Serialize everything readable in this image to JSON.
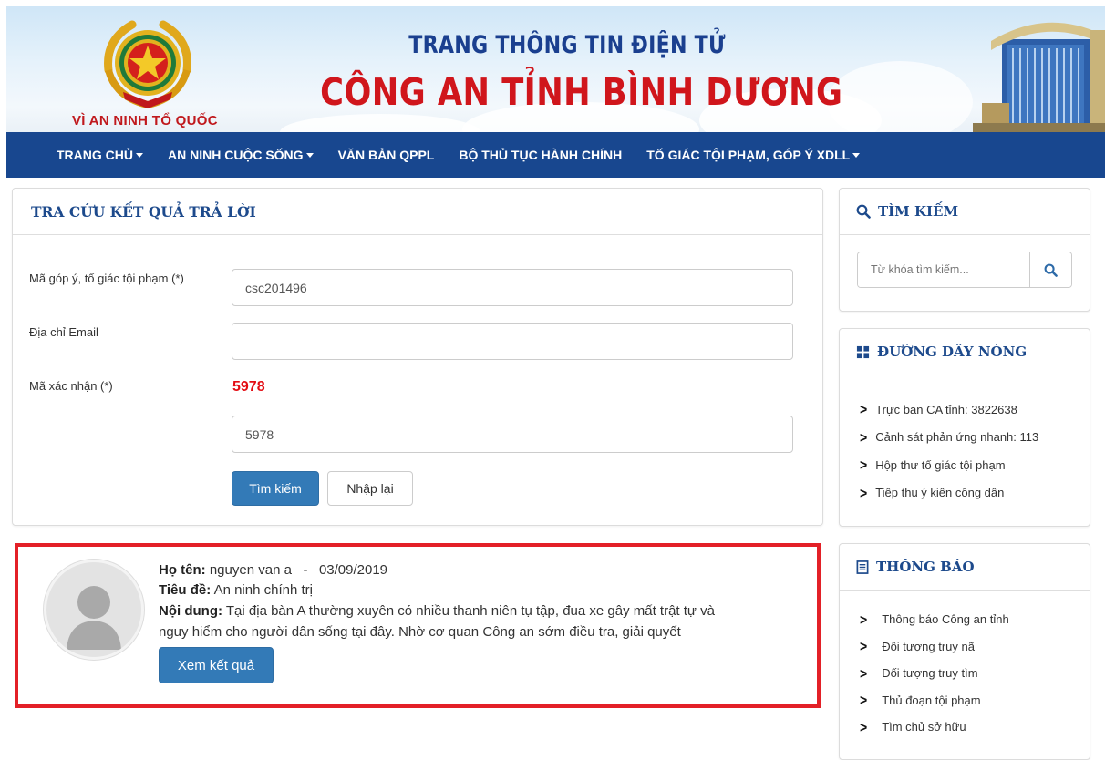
{
  "banner": {
    "motto": "VÌ AN NINH TỔ QUỐC",
    "title_top": "TRANG THÔNG TIN ĐIỆN TỬ",
    "title_main": "CÔNG AN TỈNH BÌNH DƯƠNG"
  },
  "nav": {
    "items": [
      {
        "label": "TRANG CHỦ",
        "has_dropdown": true
      },
      {
        "label": "AN NINH CUỘC SỐNG",
        "has_dropdown": true
      },
      {
        "label": "VĂN BẢN QPPL",
        "has_dropdown": false
      },
      {
        "label": "BỘ THỦ TỤC HÀNH CHÍNH",
        "has_dropdown": false
      },
      {
        "label": "TỐ GIÁC TỘI PHẠM, GÓP Ý XDLL",
        "has_dropdown": true
      }
    ]
  },
  "lookup": {
    "heading": "TRA CỨU KẾT QUẢ TRẢ LỜI",
    "code_label": "Mã góp ý, tố giác tội phạm (*)",
    "code_value": "csc201496",
    "email_label": "Địa chỉ Email",
    "email_value": "",
    "captcha_label": "Mã xác nhận (*)",
    "captcha_code": "5978",
    "captcha_value": "5978",
    "search_button": "Tìm kiếm",
    "reset_button": "Nhập lại"
  },
  "result": {
    "name_label": "Họ tên:",
    "name_value": "nguyen van a",
    "separator": "-",
    "date": "03/09/2019",
    "subject_label": "Tiêu đề:",
    "subject_value": "An ninh chính trị",
    "content_label": "Nội dung:",
    "content_line1": "Tại địa bàn A thường xuyên có nhiều thanh niên tụ tập, đua xe gây mất trật tự và",
    "content_line2": "nguy hiểm cho người dân sống tại đây. Nhờ cơ quan Công an sớm điều tra, giải quyết",
    "view_button": "Xem kết quả"
  },
  "sidebar": {
    "search": {
      "heading": "TÌM KIẾM",
      "placeholder": "Từ khóa tìm kiếm..."
    },
    "hotline": {
      "heading": "ĐƯỜNG DÂY NÓNG",
      "items": [
        "Trực ban CA tỉnh: 3822638",
        "Cảnh sát phản ứng nhanh: 113",
        "Hộp thư tố giác tội phạm",
        "Tiếp thu ý kiến công dân"
      ]
    },
    "notice": {
      "heading": "THÔNG BÁO",
      "items": [
        "Thông báo Công an tỉnh",
        "Đối tượng truy nã",
        "Đối tượng truy tìm",
        "Thủ đoạn tội phạm",
        "Tìm chủ sở hữu"
      ]
    }
  },
  "colors": {
    "nav_bg": "#18478f",
    "heading_blue": "#1d4a8c",
    "title_red": "#d0161c",
    "captcha_red": "#e30d14",
    "result_border": "#e32027",
    "button_blue": "#337ab7"
  }
}
